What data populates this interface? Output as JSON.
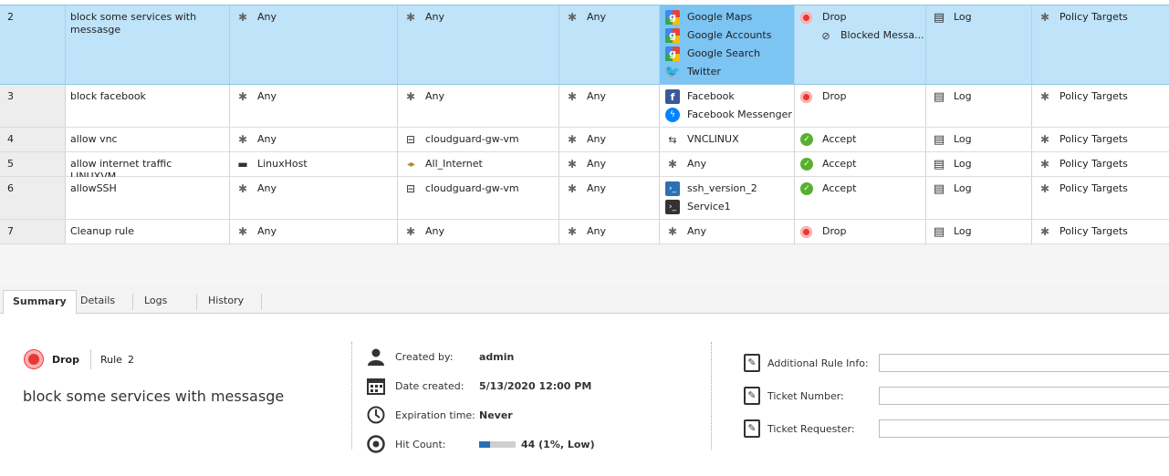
{
  "rules": [
    {
      "num": "2",
      "name": "block some services with messasge",
      "source": [
        {
          "icon": "asterisk-icon",
          "label": "Any"
        }
      ],
      "destination": [
        {
          "icon": "asterisk-icon",
          "label": "Any"
        }
      ],
      "vpn": [
        {
          "icon": "asterisk-icon",
          "label": "Any"
        }
      ],
      "services": [
        {
          "icon": "google-icon",
          "label": "Google Maps"
        },
        {
          "icon": "google-icon",
          "label": "Google Accounts"
        },
        {
          "icon": "google-icon",
          "label": "Google Search"
        },
        {
          "icon": "twitter-icon",
          "label": "Twitter"
        }
      ],
      "action": [
        {
          "icon": "drop-icon",
          "label": "Drop"
        },
        {
          "icon": "blocked-message-icon",
          "label": "Blocked Messa..."
        }
      ],
      "track": [
        {
          "icon": "log-icon",
          "label": "Log"
        }
      ],
      "install_on": [
        {
          "icon": "asterisk-icon",
          "label": "Policy Targets"
        }
      ]
    },
    {
      "num": "3",
      "name": "block facebook",
      "source": [
        {
          "icon": "asterisk-icon",
          "label": "Any"
        }
      ],
      "destination": [
        {
          "icon": "asterisk-icon",
          "label": "Any"
        }
      ],
      "vpn": [
        {
          "icon": "asterisk-icon",
          "label": "Any"
        }
      ],
      "services": [
        {
          "icon": "facebook-icon",
          "label": "Facebook"
        },
        {
          "icon": "messenger-icon",
          "label": "Facebook Messenger"
        }
      ],
      "action": [
        {
          "icon": "drop-icon",
          "label": "Drop"
        }
      ],
      "track": [
        {
          "icon": "log-icon",
          "label": "Log"
        }
      ],
      "install_on": [
        {
          "icon": "asterisk-icon",
          "label": "Policy Targets"
        }
      ]
    },
    {
      "num": "4",
      "name": "allow vnc",
      "source": [
        {
          "icon": "asterisk-icon",
          "label": "Any"
        }
      ],
      "destination": [
        {
          "icon": "gateway-icon",
          "label": "cloudguard-gw-vm"
        }
      ],
      "vpn": [
        {
          "icon": "asterisk-icon",
          "label": "Any"
        }
      ],
      "services": [
        {
          "icon": "tcp-service-icon",
          "label": "VNCLINUX"
        }
      ],
      "action": [
        {
          "icon": "accept-icon",
          "label": "Accept"
        }
      ],
      "track": [
        {
          "icon": "log-icon",
          "label": "Log"
        }
      ],
      "install_on": [
        {
          "icon": "asterisk-icon",
          "label": "Policy Targets"
        }
      ]
    },
    {
      "num": "5",
      "name": "allow internet traffic LINUXVM",
      "source": [
        {
          "icon": "host-icon",
          "label": "LinuxHost"
        }
      ],
      "destination": [
        {
          "icon": "internet-icon",
          "label": "All_Internet"
        }
      ],
      "vpn": [
        {
          "icon": "asterisk-icon",
          "label": "Any"
        }
      ],
      "services": [
        {
          "icon": "asterisk-icon",
          "label": "Any"
        }
      ],
      "action": [
        {
          "icon": "accept-icon",
          "label": "Accept"
        }
      ],
      "track": [
        {
          "icon": "log-icon",
          "label": "Log"
        }
      ],
      "install_on": [
        {
          "icon": "asterisk-icon",
          "label": "Policy Targets"
        }
      ]
    },
    {
      "num": "6",
      "name": "allowSSH",
      "source": [
        {
          "icon": "asterisk-icon",
          "label": "Any"
        }
      ],
      "destination": [
        {
          "icon": "gateway-icon",
          "label": "cloudguard-gw-vm"
        }
      ],
      "vpn": [
        {
          "icon": "asterisk-icon",
          "label": "Any"
        }
      ],
      "services": [
        {
          "icon": "ssh-icon",
          "label": "ssh_version_2"
        },
        {
          "icon": "terminal-icon",
          "label": "Service1"
        }
      ],
      "action": [
        {
          "icon": "accept-icon",
          "label": "Accept"
        }
      ],
      "track": [
        {
          "icon": "log-icon",
          "label": "Log"
        }
      ],
      "install_on": [
        {
          "icon": "asterisk-icon",
          "label": "Policy Targets"
        }
      ]
    },
    {
      "num": "7",
      "name": "Cleanup rule",
      "source": [
        {
          "icon": "asterisk-icon",
          "label": "Any"
        }
      ],
      "destination": [
        {
          "icon": "asterisk-icon",
          "label": "Any"
        }
      ],
      "vpn": [
        {
          "icon": "asterisk-icon",
          "label": "Any"
        }
      ],
      "services": [
        {
          "icon": "asterisk-icon",
          "label": "Any"
        }
      ],
      "action": [
        {
          "icon": "drop-icon",
          "label": "Drop"
        }
      ],
      "track": [
        {
          "icon": "log-icon",
          "label": "Log"
        }
      ],
      "install_on": [
        {
          "icon": "asterisk-icon",
          "label": "Policy Targets"
        }
      ]
    }
  ],
  "tabs": [
    {
      "label": "Summary",
      "active": true
    },
    {
      "label": "Details",
      "active": false
    },
    {
      "label": "Logs",
      "active": false
    },
    {
      "label": "History",
      "active": false
    }
  ],
  "summary": {
    "action": "Drop",
    "rule_label": "Rule",
    "rule_number": "2",
    "title": "block some services with messasge",
    "created_by_label": "Created by:",
    "created_by": "admin",
    "date_created_label": "Date created:",
    "date_created": "5/13/2020 12:00 PM",
    "expiration_label": "Expiration time:",
    "expiration": "Never",
    "hit_count_label": "Hit Count:",
    "hit_count": "44 (1%, Low)",
    "hit_level_percent": 30,
    "fields": [
      {
        "label": "Additional Rule Info:",
        "value": ""
      },
      {
        "label": "Ticket Number:",
        "value": ""
      },
      {
        "label": "Ticket Requester:",
        "value": ""
      }
    ]
  },
  "colors": {
    "selected_row": "#bfe3f9",
    "selected_cell": "#7cc4f2",
    "drop": "#e53935",
    "accept": "#58b030",
    "hit_bar": "#2a6ebb"
  }
}
